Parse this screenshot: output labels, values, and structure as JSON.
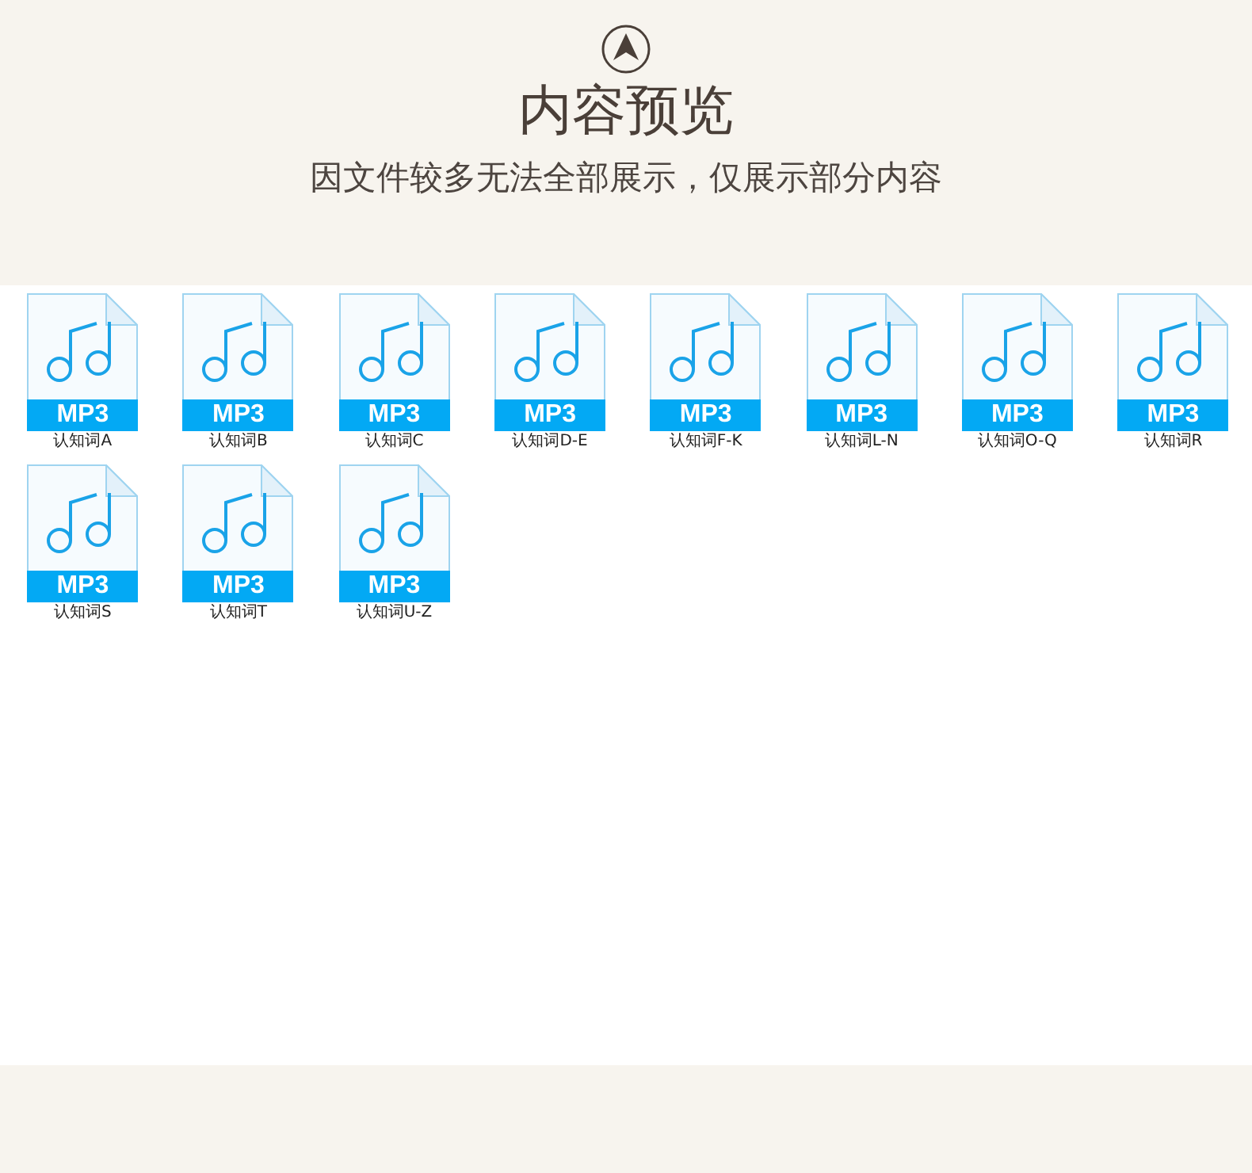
{
  "header": {
    "title": "内容预览",
    "subtitle": "因文件较多无法全部展示，仅展示部分内容"
  },
  "files": [
    {
      "name": "认知词A",
      "type": "MP3"
    },
    {
      "name": "认知词B",
      "type": "MP3"
    },
    {
      "name": "认知词C",
      "type": "MP3"
    },
    {
      "name": "认知词D-E",
      "type": "MP3"
    },
    {
      "name": "认知词F-K",
      "type": "MP3"
    },
    {
      "name": "认知词L-N",
      "type": "MP3"
    },
    {
      "name": "认知词O-Q",
      "type": "MP3"
    },
    {
      "name": "认知词R",
      "type": "MP3"
    },
    {
      "name": "认知词S",
      "type": "MP3"
    },
    {
      "name": "认知词T",
      "type": "MP3"
    },
    {
      "name": "认知词U-Z",
      "type": "MP3"
    }
  ]
}
